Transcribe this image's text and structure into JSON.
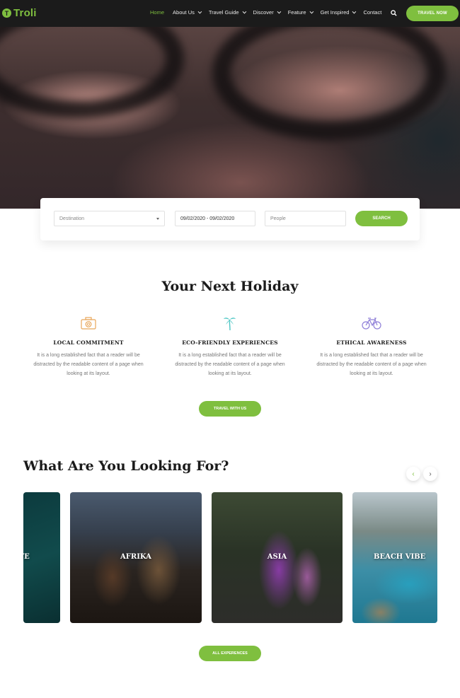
{
  "brand": {
    "name": "Troli",
    "mark": "T"
  },
  "nav": {
    "items": [
      {
        "label": "Home",
        "active": true,
        "dropdown": false
      },
      {
        "label": "About Us",
        "active": false,
        "dropdown": true
      },
      {
        "label": "Travel Guide",
        "active": false,
        "dropdown": true
      },
      {
        "label": "Discover",
        "active": false,
        "dropdown": true
      },
      {
        "label": "Feature",
        "active": false,
        "dropdown": true
      },
      {
        "label": "Get Inspired",
        "active": false,
        "dropdown": true
      },
      {
        "label": "Contact",
        "active": false,
        "dropdown": false
      }
    ],
    "search_icon": "search-icon",
    "cta_label": "TRAVEL NOW"
  },
  "search": {
    "destination_placeholder": "Destination",
    "date_value": "09/02/2020 - 09/02/2020",
    "people_placeholder": "People",
    "button_label": "SEARCH"
  },
  "holiday": {
    "title": "Your Next Holiday",
    "features": [
      {
        "icon": "camera-icon",
        "title": "LOCAL COMMITMENT",
        "text": "It is a long established fact that a reader will be distracted by the readable content of a page when looking at its layout."
      },
      {
        "icon": "palm-tree-icon",
        "title": "ECO-FRIENDLY EXPERIENCES",
        "text": "It is a long established fact that a reader will be distracted by the readable content of a page when looking at its layout."
      },
      {
        "icon": "bicycle-icon",
        "title": "ETHICAL AWARENESS",
        "text": "It is a long established fact that a reader will be distracted by the readable content of a page when looking at its layout."
      }
    ],
    "button_label": "TRAVEL WITH US"
  },
  "looking": {
    "title": "What Are You Looking For?",
    "prev_label": "‹",
    "next_label": "›",
    "cards": [
      {
        "label": "FE"
      },
      {
        "label": "AFRIKA"
      },
      {
        "label": "ASIA"
      },
      {
        "label": "BEACH VIBE"
      }
    ],
    "button_label": "ALL EXPERENCES"
  },
  "colors": {
    "accent": "#7fbf3f",
    "header_bg": "#1b1b1b",
    "feature_icon_orange": "#e8a65a",
    "feature_icon_teal": "#4cc6c4",
    "feature_icon_purple": "#8f7fd8"
  }
}
